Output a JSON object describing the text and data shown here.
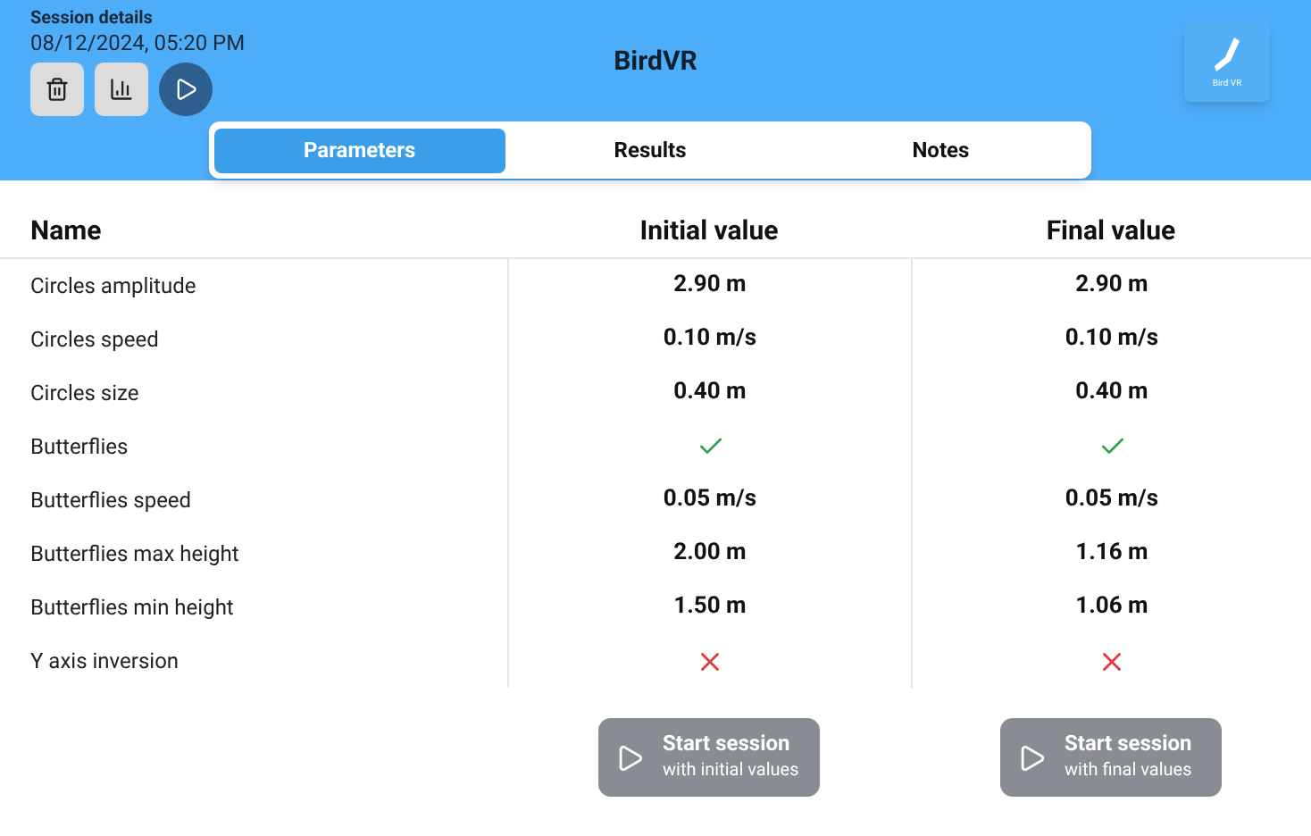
{
  "header": {
    "label": "Session details",
    "datetime": "08/12/2024, 05:20 PM",
    "title": "BirdVR",
    "logo_text": "Bird VR"
  },
  "tabs": [
    {
      "label": "Parameters",
      "selected": true
    },
    {
      "label": "Results",
      "selected": false
    },
    {
      "label": "Notes",
      "selected": false
    }
  ],
  "table": {
    "columns": [
      "Name",
      "Initial value",
      "Final value"
    ],
    "rows": [
      {
        "name": "Circles amplitude",
        "initial": {
          "kind": "text",
          "text": "2.90 m"
        },
        "final": {
          "kind": "text",
          "text": "2.90 m"
        }
      },
      {
        "name": "Circles speed",
        "initial": {
          "kind": "text",
          "text": "0.10 m/s"
        },
        "final": {
          "kind": "text",
          "text": "0.10 m/s"
        }
      },
      {
        "name": "Circles size",
        "initial": {
          "kind": "text",
          "text": "0.40 m"
        },
        "final": {
          "kind": "text",
          "text": "0.40 m"
        }
      },
      {
        "name": "Butterflies",
        "initial": {
          "kind": "check"
        },
        "final": {
          "kind": "check"
        }
      },
      {
        "name": "Butterflies speed",
        "initial": {
          "kind": "text",
          "text": "0.05 m/s"
        },
        "final": {
          "kind": "text",
          "text": "0.05 m/s"
        }
      },
      {
        "name": "Butterflies max height",
        "initial": {
          "kind": "text",
          "text": "2.00 m"
        },
        "final": {
          "kind": "text",
          "text": "1.16 m"
        }
      },
      {
        "name": "Butterflies min height",
        "initial": {
          "kind": "text",
          "text": "1.50 m"
        },
        "final": {
          "kind": "text",
          "text": "1.06 m"
        }
      },
      {
        "name": "Y axis inversion",
        "initial": {
          "kind": "cross"
        },
        "final": {
          "kind": "cross"
        }
      }
    ]
  },
  "actions": [
    {
      "title": "Start session",
      "subtitle": "with initial values",
      "disabled": true
    },
    {
      "title": "Start session",
      "subtitle": "with final values",
      "disabled": true
    }
  ]
}
